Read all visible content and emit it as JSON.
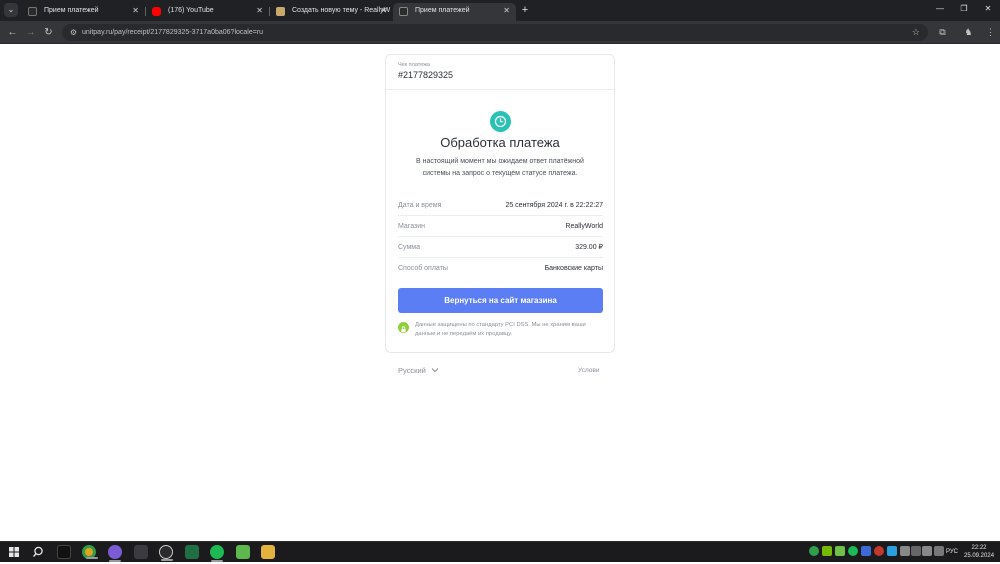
{
  "browser": {
    "tabs": [
      {
        "title": "Прием платежей",
        "favicon": "unitpay-favicon",
        "active": false
      },
      {
        "title": "(176) YouTube",
        "favicon": "youtube-favicon",
        "active": false
      },
      {
        "title": "Создать новую тему - ReallyW",
        "favicon": "forum-favicon",
        "active": false
      },
      {
        "title": "Прием платежей",
        "favicon": "unitpay-favicon",
        "active": true
      }
    ],
    "url": "unitpay.ru/pay/receipt/2177829325-3717a0ba06?locale=ru"
  },
  "receipt": {
    "label": "Чек платежа",
    "number": "#2177829325"
  },
  "status": {
    "title": "Обработка платежа",
    "description": "В настоящий момент мы ожидаем ответ платёжной системы на запрос о текущем статусе платежа.",
    "icon": "clock-icon",
    "color": "#29c2b4"
  },
  "details": [
    {
      "key": "Дата и время",
      "value": "25 сентября 2024 г. в 22:22:27"
    },
    {
      "key": "Магазин",
      "value": "ReallyWorld"
    },
    {
      "key": "Сумма",
      "value": "329.00 ₽"
    },
    {
      "key": "Способ оплаты",
      "value": "Банковские карты"
    }
  ],
  "back_button": {
    "label": "Вернуться на сайт магазина",
    "color": "#5b7ef5"
  },
  "security_note": "Данные защищены по стандарту PCI DSS. Мы не храним ваши данные и не передаём их продавцу.",
  "footer": {
    "language": "Русский",
    "terms": "Услови"
  },
  "taskbar": {
    "lang": "РУС",
    "time": "22:22",
    "date": "25.09.2024"
  }
}
